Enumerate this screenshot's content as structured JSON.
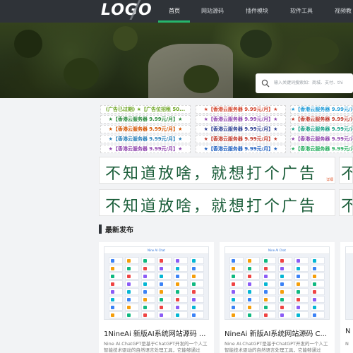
{
  "header": {
    "logo": "LOGO",
    "nav": [
      "首页",
      "网站源码",
      "插件模块",
      "软件工具",
      "视频教程"
    ]
  },
  "search": {
    "placeholder": "输入关键词搜索如：商城、支付、thi"
  },
  "ads": [
    [
      "(广告已过期)  ★【广告位招租  50...",
      "★【香港云服务器 9.99元/月】★",
      "★【香港云服务器 9.99元/月"
    ],
    [
      "★【香港云服务器 9.99元/月】★",
      "★【香港云服务器 9.99元/月】★",
      "★【香港云服务器 9.99元/月"
    ],
    [
      "★【香港云服务器 9.99元/月】★",
      "★【香港云服务器 9.99元/月】★",
      "★【香港云服务器 9.99元/月"
    ],
    [
      "★【香港云服务器 9.99元/月】★",
      "★【香港云服务器 9.99元/月】★",
      "★【香港云服务器 9.99元/月"
    ],
    [
      "★【香港云服务器 9.99元/月】★",
      "★【香港云服务器 9.99元/月】★",
      "★【香港云服务器 9.99元/月"
    ]
  ],
  "ad_colors": [
    [
      "#6aa31f",
      "#d2432b",
      "#1e9ad6"
    ],
    [
      "#2b8a3e",
      "#8e44ad",
      "#c0392b"
    ],
    [
      "#d35400",
      "#2c3e91",
      "#16a085"
    ],
    [
      "#2980b9",
      "#c0392b",
      "#8e44ad"
    ],
    [
      "#8e44ad",
      "#1f5fbf",
      "#27ae60"
    ]
  ],
  "big_ads": {
    "text": "不知道放啥，就想打个广告",
    "tag": "详细",
    "edge_char": "不"
  },
  "section": {
    "title": "最新发布"
  },
  "cards": [
    {
      "thumb_title": "Nine AI Chat",
      "title": "1NineAi 新版AI系统网站源码 ...",
      "desc": "Nine AI.ChatGPT是基于ChatGPT开发的一个人工智能技术驱动的自然语言处理工具，它能够通过"
    },
    {
      "thumb_title": "Nine AI Chat",
      "title": "NineAi 新版AI系统网站源码 C...",
      "desc": "Nine AI.ChatGPT是基于ChatGPT开发的一个人工智能技术驱动的自然语言处理工具，它能够通过"
    },
    {
      "thumb_title": "",
      "title": "N",
      "desc": "N"
    }
  ],
  "colors": {
    "header_bg": "#2f3338",
    "accent": "#26b66d",
    "ad_text": "#1b5e3a"
  }
}
